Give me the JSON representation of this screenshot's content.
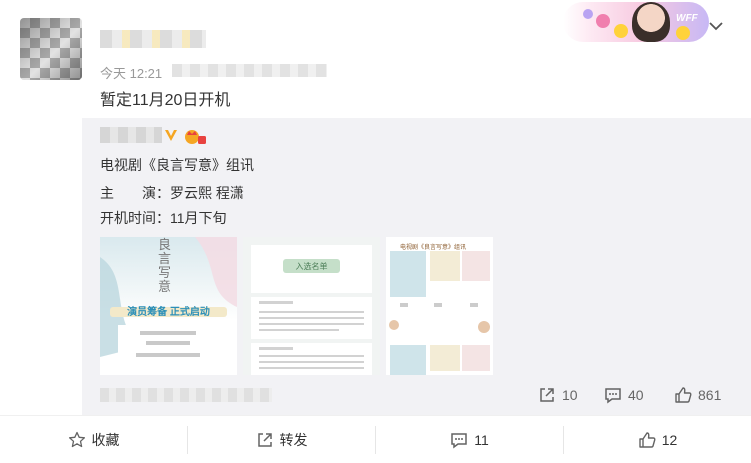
{
  "post": {
    "timestamp": "今天 12:21",
    "text": "暂定11月20日开机"
  },
  "repost": {
    "line1": "电视剧《良言写意》组讯",
    "line2": "主　　演：罗云熙 程潇",
    "line3": "开机时间：11月下旬",
    "stats": {
      "share_count": "10",
      "comment_count": "40",
      "like_count": "861"
    },
    "images": [
      {
        "title": "良言写意",
        "subtitle": "演员筹备 正式启动"
      },
      {
        "title": "入选名单"
      },
      {
        "title": "电视剧《良言写意》组讯"
      }
    ]
  },
  "actions": {
    "favorite_label": "收藏",
    "forward_label": "转发",
    "comment_count": "11",
    "like_count": "12"
  },
  "colors": {
    "repost_bg": "#f2f2f5",
    "accent_gold": "#f5a623",
    "icon_gray": "#636363"
  }
}
